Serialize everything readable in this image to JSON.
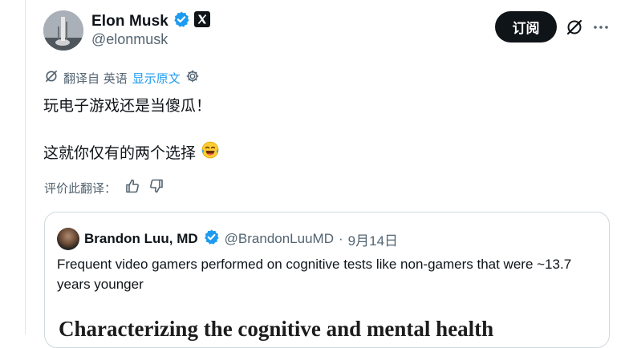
{
  "author": {
    "display_name": "Elon Musk",
    "handle": "@elonmusk",
    "verified": true,
    "affiliate_badge": "x-logo-icon"
  },
  "actions": {
    "subscribe_label": "订阅",
    "grok_icon": "grok-icon",
    "more_icon": "more-icon"
  },
  "translation": {
    "translated_from": "翻译自 英语",
    "show_original": "显示原文",
    "settings_icon": "gear-icon"
  },
  "tweet": {
    "line1": "玩电子游戏还是当傻瓜！",
    "line2": "这就你仅有的两个选择",
    "emoji": "😂"
  },
  "rating": {
    "label": "评价此翻译：",
    "up_icon": "thumbs-up-icon",
    "down_icon": "thumbs-down-icon"
  },
  "quote": {
    "display_name": "Brandon Luu, MD",
    "verified": true,
    "handle": "@BrandonLuuMD",
    "separator": "·",
    "date": "9月14日",
    "text": "Frequent video gamers performed on cognitive tests like non-gamers that were ~13.7 years younger",
    "image_title": "Characterizing the cognitive and mental health"
  },
  "colors": {
    "accent_blue": "#1d9bf0",
    "text_primary": "#0f1419",
    "text_secondary": "#536471",
    "button_bg": "#0f1419"
  }
}
